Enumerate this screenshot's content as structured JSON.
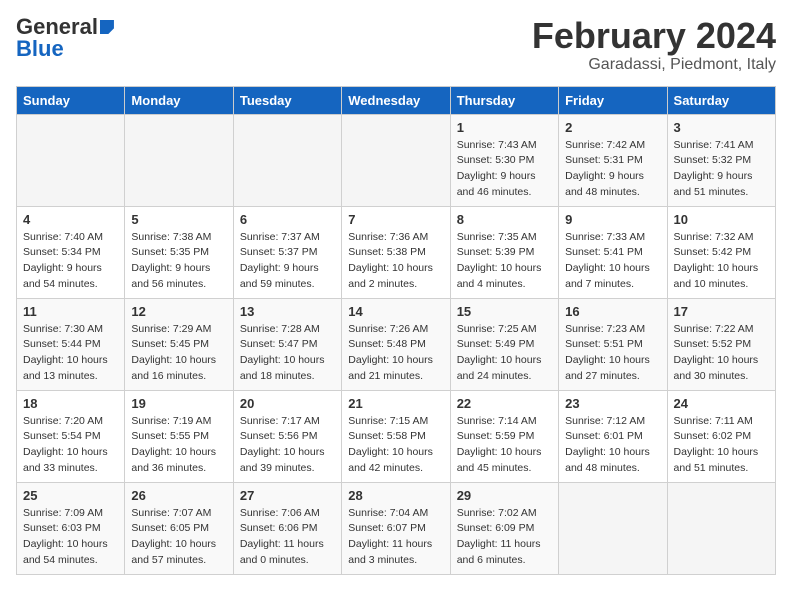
{
  "header": {
    "logo_general": "General",
    "logo_blue": "Blue",
    "title": "February 2024",
    "subtitle": "Garadassi, Piedmont, Italy"
  },
  "weekdays": [
    "Sunday",
    "Monday",
    "Tuesday",
    "Wednesday",
    "Thursday",
    "Friday",
    "Saturday"
  ],
  "weeks": [
    [
      {
        "day": "",
        "info": ""
      },
      {
        "day": "",
        "info": ""
      },
      {
        "day": "",
        "info": ""
      },
      {
        "day": "",
        "info": ""
      },
      {
        "day": "1",
        "info": "Sunrise: 7:43 AM\nSunset: 5:30 PM\nDaylight: 9 hours\nand 46 minutes."
      },
      {
        "day": "2",
        "info": "Sunrise: 7:42 AM\nSunset: 5:31 PM\nDaylight: 9 hours\nand 48 minutes."
      },
      {
        "day": "3",
        "info": "Sunrise: 7:41 AM\nSunset: 5:32 PM\nDaylight: 9 hours\nand 51 minutes."
      }
    ],
    [
      {
        "day": "4",
        "info": "Sunrise: 7:40 AM\nSunset: 5:34 PM\nDaylight: 9 hours\nand 54 minutes."
      },
      {
        "day": "5",
        "info": "Sunrise: 7:38 AM\nSunset: 5:35 PM\nDaylight: 9 hours\nand 56 minutes."
      },
      {
        "day": "6",
        "info": "Sunrise: 7:37 AM\nSunset: 5:37 PM\nDaylight: 9 hours\nand 59 minutes."
      },
      {
        "day": "7",
        "info": "Sunrise: 7:36 AM\nSunset: 5:38 PM\nDaylight: 10 hours\nand 2 minutes."
      },
      {
        "day": "8",
        "info": "Sunrise: 7:35 AM\nSunset: 5:39 PM\nDaylight: 10 hours\nand 4 minutes."
      },
      {
        "day": "9",
        "info": "Sunrise: 7:33 AM\nSunset: 5:41 PM\nDaylight: 10 hours\nand 7 minutes."
      },
      {
        "day": "10",
        "info": "Sunrise: 7:32 AM\nSunset: 5:42 PM\nDaylight: 10 hours\nand 10 minutes."
      }
    ],
    [
      {
        "day": "11",
        "info": "Sunrise: 7:30 AM\nSunset: 5:44 PM\nDaylight: 10 hours\nand 13 minutes."
      },
      {
        "day": "12",
        "info": "Sunrise: 7:29 AM\nSunset: 5:45 PM\nDaylight: 10 hours\nand 16 minutes."
      },
      {
        "day": "13",
        "info": "Sunrise: 7:28 AM\nSunset: 5:47 PM\nDaylight: 10 hours\nand 18 minutes."
      },
      {
        "day": "14",
        "info": "Sunrise: 7:26 AM\nSunset: 5:48 PM\nDaylight: 10 hours\nand 21 minutes."
      },
      {
        "day": "15",
        "info": "Sunrise: 7:25 AM\nSunset: 5:49 PM\nDaylight: 10 hours\nand 24 minutes."
      },
      {
        "day": "16",
        "info": "Sunrise: 7:23 AM\nSunset: 5:51 PM\nDaylight: 10 hours\nand 27 minutes."
      },
      {
        "day": "17",
        "info": "Sunrise: 7:22 AM\nSunset: 5:52 PM\nDaylight: 10 hours\nand 30 minutes."
      }
    ],
    [
      {
        "day": "18",
        "info": "Sunrise: 7:20 AM\nSunset: 5:54 PM\nDaylight: 10 hours\nand 33 minutes."
      },
      {
        "day": "19",
        "info": "Sunrise: 7:19 AM\nSunset: 5:55 PM\nDaylight: 10 hours\nand 36 minutes."
      },
      {
        "day": "20",
        "info": "Sunrise: 7:17 AM\nSunset: 5:56 PM\nDaylight: 10 hours\nand 39 minutes."
      },
      {
        "day": "21",
        "info": "Sunrise: 7:15 AM\nSunset: 5:58 PM\nDaylight: 10 hours\nand 42 minutes."
      },
      {
        "day": "22",
        "info": "Sunrise: 7:14 AM\nSunset: 5:59 PM\nDaylight: 10 hours\nand 45 minutes."
      },
      {
        "day": "23",
        "info": "Sunrise: 7:12 AM\nSunset: 6:01 PM\nDaylight: 10 hours\nand 48 minutes."
      },
      {
        "day": "24",
        "info": "Sunrise: 7:11 AM\nSunset: 6:02 PM\nDaylight: 10 hours\nand 51 minutes."
      }
    ],
    [
      {
        "day": "25",
        "info": "Sunrise: 7:09 AM\nSunset: 6:03 PM\nDaylight: 10 hours\nand 54 minutes."
      },
      {
        "day": "26",
        "info": "Sunrise: 7:07 AM\nSunset: 6:05 PM\nDaylight: 10 hours\nand 57 minutes."
      },
      {
        "day": "27",
        "info": "Sunrise: 7:06 AM\nSunset: 6:06 PM\nDaylight: 11 hours\nand 0 minutes."
      },
      {
        "day": "28",
        "info": "Sunrise: 7:04 AM\nSunset: 6:07 PM\nDaylight: 11 hours\nand 3 minutes."
      },
      {
        "day": "29",
        "info": "Sunrise: 7:02 AM\nSunset: 6:09 PM\nDaylight: 11 hours\nand 6 minutes."
      },
      {
        "day": "",
        "info": ""
      },
      {
        "day": "",
        "info": ""
      }
    ]
  ]
}
